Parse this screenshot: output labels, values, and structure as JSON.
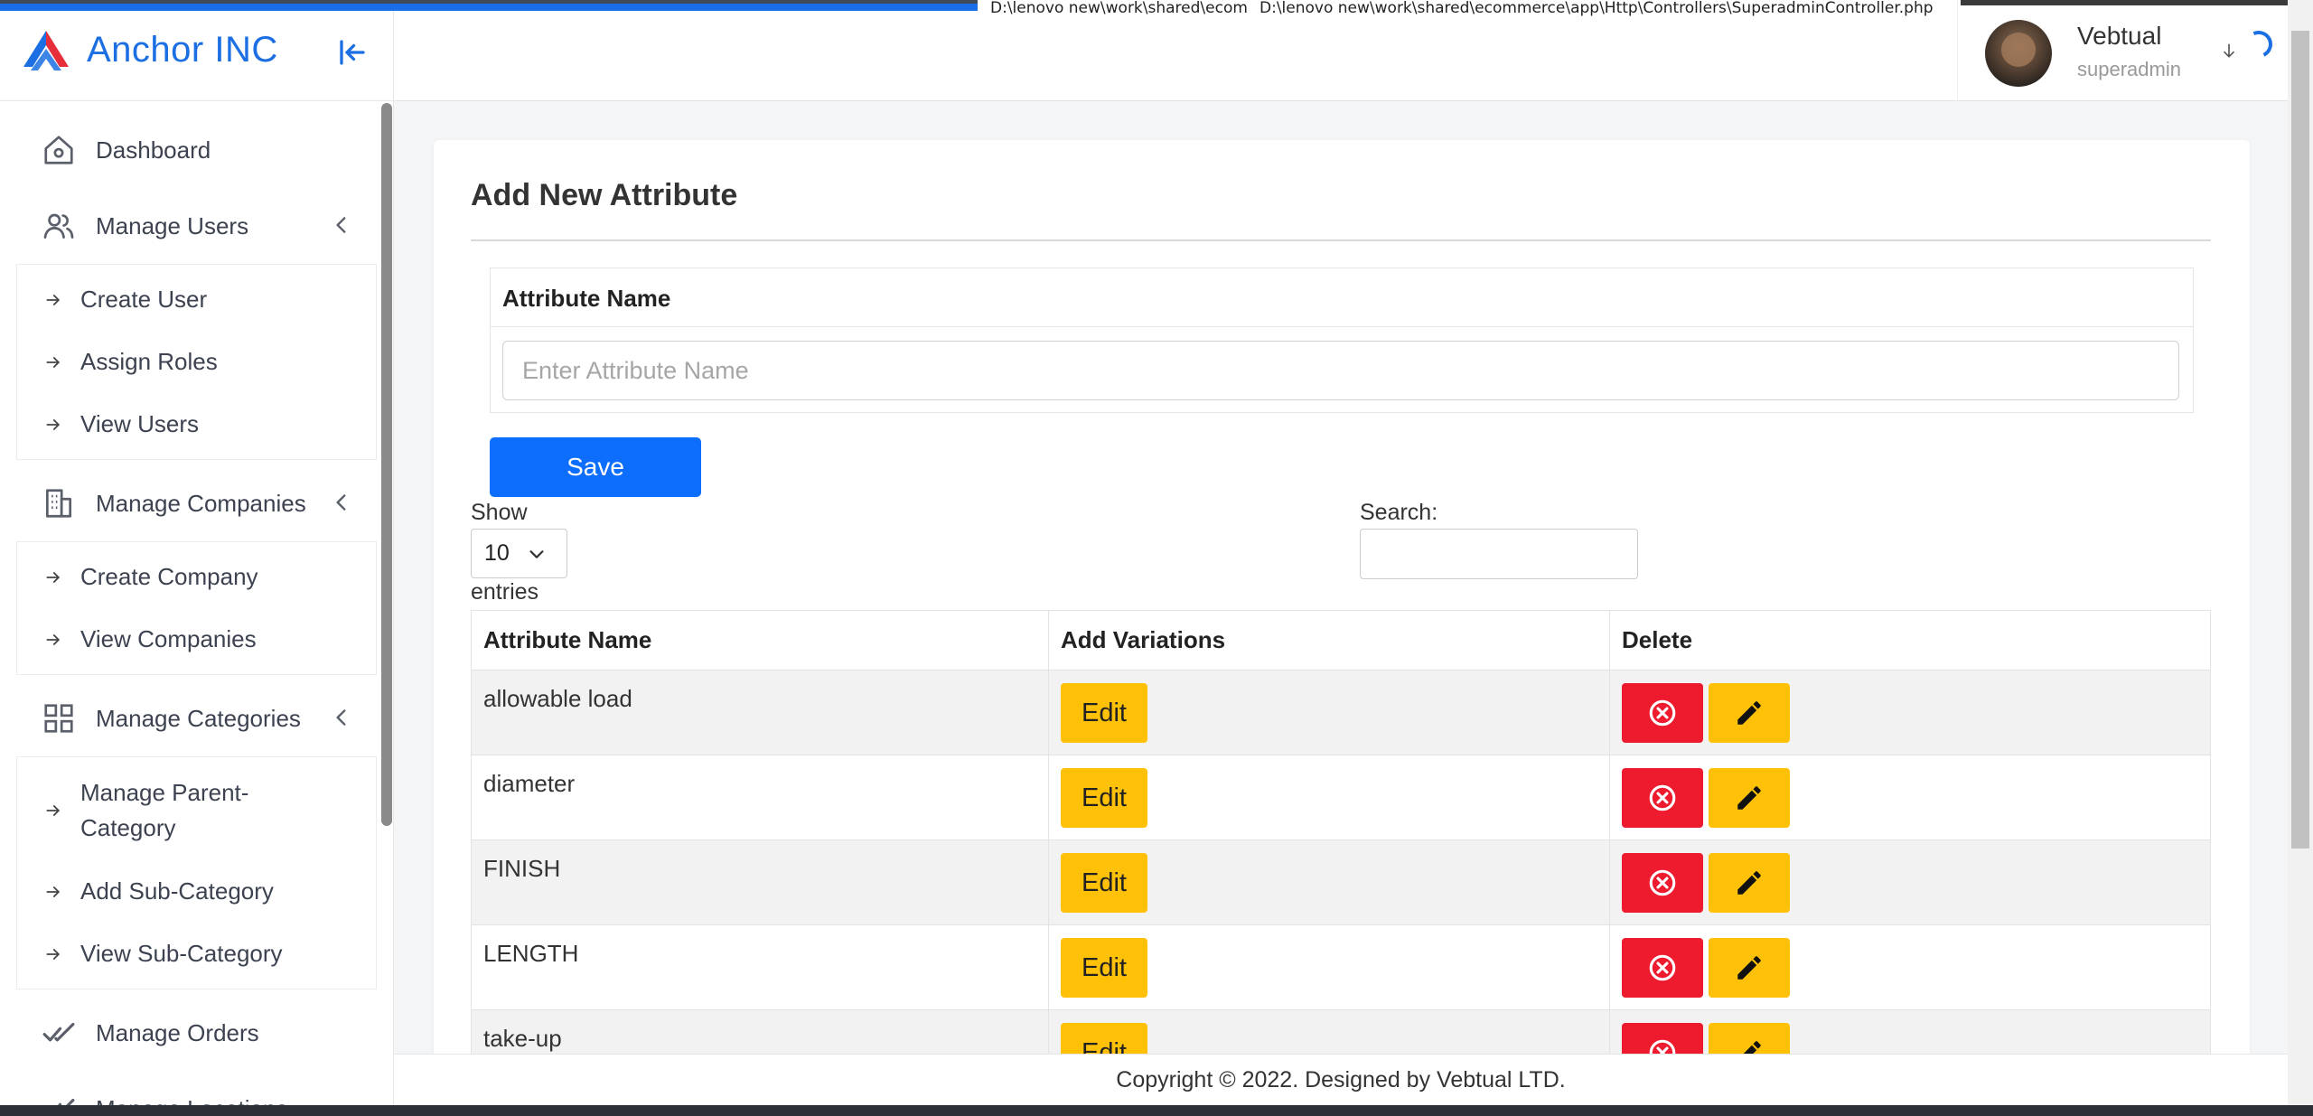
{
  "debug": {
    "path_1": "D:\\lenovo new\\work\\shared\\ecommerce\\app\\Http\\Controllers\\SuperadminController.php",
    "path_2": "D:\\lenovo new\\work\\shared\\ecommerce\\app\\Http\\Controllers\\SuperadminController.php"
  },
  "brand": {
    "name": "Anchor INC"
  },
  "sidebar": {
    "dashboard": "Dashboard",
    "users": {
      "label": "Manage Users",
      "items": [
        "Create User",
        "Assign Roles",
        "View Users"
      ]
    },
    "companies": {
      "label": "Manage Companies",
      "items": [
        "Create Company",
        "View Companies"
      ]
    },
    "categories": {
      "label": "Manage Categories",
      "items": [
        "Manage Parent-Category",
        "Add Sub-Category",
        "View Sub-Category"
      ]
    },
    "orders": "Manage Orders",
    "locations": "Manage Locations"
  },
  "user": {
    "name": "Vebtual",
    "role": "superadmin"
  },
  "form": {
    "title": "Add New Attribute",
    "field_label": "Attribute Name",
    "placeholder": "Enter Attribute Name",
    "save": "Save"
  },
  "datatable": {
    "show_label": "Show",
    "page_size": "10",
    "entries_label": "entries",
    "search_label": "Search:",
    "columns": [
      "Attribute Name",
      "Add Variations",
      "Delete"
    ],
    "edit_label": "Edit",
    "rows": [
      {
        "name": "allowable load"
      },
      {
        "name": "diameter"
      },
      {
        "name": "FINISH"
      },
      {
        "name": "LENGTH"
      },
      {
        "name": "take-up"
      }
    ]
  },
  "footer": {
    "text": "Copyright © 2022. Designed by Vebtual LTD."
  },
  "colors": {
    "primary": "#0d6efd",
    "brand": "#1b6fe3",
    "warning": "#ffc107",
    "danger": "#ee1a2e"
  }
}
